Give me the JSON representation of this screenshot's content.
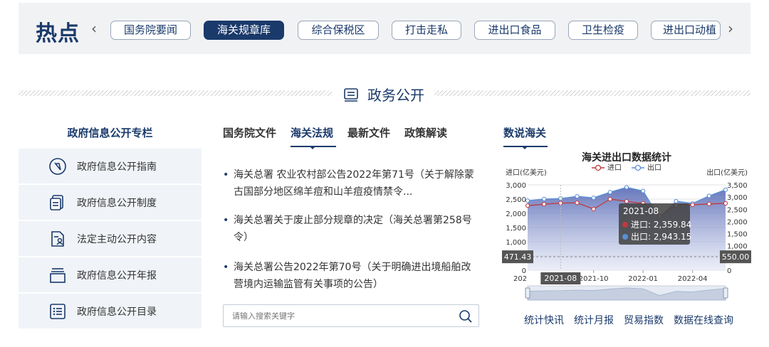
{
  "hot": {
    "title": "热点",
    "tags": [
      "国务院要闻",
      "海关规章库",
      "综合保税区",
      "打击走私",
      "进出口食品",
      "卫生检疫",
      "进出口动植"
    ],
    "active_index": 1
  },
  "section": {
    "title": "政务公开"
  },
  "left": {
    "heading": "政府信息公开专栏",
    "items": [
      "政府信息公开指南",
      "政府信息公开制度",
      "法定主动公开内容",
      "政府信息公开年报",
      "政府信息公开目录"
    ]
  },
  "middle": {
    "tabs": [
      "国务院文件",
      "海关法规",
      "最新文件",
      "政策解读"
    ],
    "active_tab": 1,
    "news": [
      "海关总署 农业农村部公告2022年第71号（关于解除蒙古国部分地区绵羊痘和山羊痘疫情禁令...",
      "海关总署关于废止部分规章的决定（海关总署第258号令）",
      "海关总署公告2022年第70号（关于明确进出境船舶改营境内运输监管有关事项的公告）"
    ],
    "search_placeholder": "请输入搜索关键字"
  },
  "right": {
    "heading": "数说海关",
    "links": [
      "统计快讯",
      "统计月报",
      "贸易指数",
      "数据在线查询"
    ]
  },
  "chart_data": {
    "type": "line",
    "title": "海关进出口数据统计",
    "legend": [
      "进口",
      "出口"
    ],
    "legend_position": "top",
    "ylabel_left": "进口(亿美元)",
    "ylabel_right": "出口(亿美元)",
    "yticks_left": [
      "3,000",
      "2,500",
      "2,000",
      "1,500",
      "1,000",
      "500",
      "0"
    ],
    "yticks_right": [
      "3,500",
      "3,000",
      "2,500",
      "2,000",
      "1,500",
      "1,000",
      "500",
      "0"
    ],
    "ylim_left": [
      0,
      3000
    ],
    "ylim_right": [
      0,
      3500
    ],
    "x_tick_labels": [
      "2021-10",
      "2022-01",
      "2022-04"
    ],
    "x": [
      "2021-06",
      "2021-07",
      "2021-08",
      "2021-09",
      "2021-10",
      "2021-11",
      "2021-12",
      "2022-01",
      "2022-02",
      "2022-03",
      "2022-04",
      "2022-05",
      "2022-06"
    ],
    "series": [
      {
        "name": "进口",
        "color": "#c0393f",
        "axis": "left",
        "values": [
          2270,
          2320,
          2359.84,
          2370,
          2150,
          2500,
          2420,
          2350,
          1900,
          2280,
          2300,
          2330,
          2350
        ]
      },
      {
        "name": "出口",
        "color": "#5b8fd6",
        "axis": "right",
        "values": [
          2850,
          2920,
          2943.15,
          3030,
          2970,
          3200,
          3400,
          3250,
          2150,
          2830,
          2740,
          3050,
          3300
        ]
      }
    ],
    "tooltip": {
      "date": "2021-08",
      "import_label": "进口: 2,359.84",
      "export_label": "出口: 2,943.15"
    },
    "crosshair": {
      "left_value": "471.43",
      "right_value": "550.00",
      "x_label": "2021-08"
    },
    "x_start_label_visible": "202",
    "grid": true
  }
}
